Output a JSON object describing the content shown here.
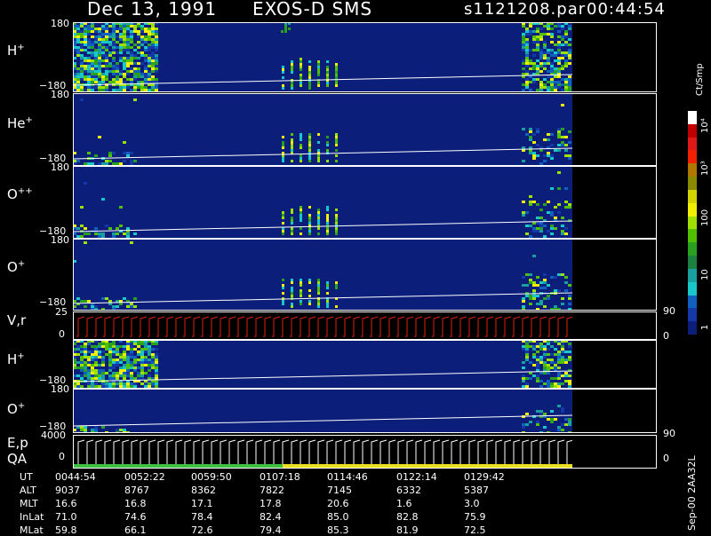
{
  "header": {
    "date": "Dec 13, 1991",
    "mission": "EXOS-D SMS",
    "file": "s1121208.par",
    "time": "00:44:54"
  },
  "panels": [
    {
      "label": "H",
      "sup": "+",
      "top_tick": "180",
      "bottom_tick": "−180"
    },
    {
      "label": "He",
      "sup": "+",
      "top_tick": "180",
      "bottom_tick": "−180"
    },
    {
      "label": "O",
      "sup": "++",
      "top_tick": "180",
      "bottom_tick": "−180"
    },
    {
      "label": "O",
      "sup": "+",
      "top_tick": "180",
      "bottom_tick": "−180"
    },
    {
      "label": "V,r",
      "sup": "",
      "top_tick": "25",
      "bottom_tick": "0"
    },
    {
      "label": "H",
      "sup": "+",
      "top_tick": "180",
      "bottom_tick": "−180"
    },
    {
      "label": "O",
      "sup": "+",
      "top_tick": "180",
      "bottom_tick": "−180"
    },
    {
      "label": "E,p",
      "sup": "",
      "top_tick": "4000",
      "bottom_tick": "0"
    },
    {
      "label": "QA",
      "sup": "",
      "top_tick": "",
      "bottom_tick": ""
    }
  ],
  "right_ticks": {
    "vr_top": "90",
    "vr_bottom": "0",
    "ep_top": "90",
    "ep_bottom": "0"
  },
  "colorbar": {
    "units": "Ct/Smp",
    "ticks": [
      "10⁴",
      "10³",
      "100",
      "10",
      "1"
    ],
    "colors": [
      "#ffffff",
      "#c00000",
      "#e01818",
      "#f02000",
      "#b07800",
      "#8a8a00",
      "#d4d400",
      "#f0f000",
      "#a0e000",
      "#50c000",
      "#2aa020",
      "#1c8040",
      "#18a0a0",
      "#18c8c8",
      "#1060c0",
      "#1438a8",
      "#0b1e7a"
    ]
  },
  "footer_text": "Sep-00  2AA32L",
  "orbit_table": {
    "labels": [
      "UT",
      "ALT",
      "MLT",
      "InLat",
      "MLat"
    ],
    "rows": [
      [
        "0044:54",
        "0052:22",
        "0059:50",
        "0107:18",
        "0114:46",
        "0122:14",
        "0129:42"
      ],
      [
        "9037",
        "8767",
        "8362",
        "7822",
        "7145",
        "6332",
        "5387"
      ],
      [
        "16.6",
        "16.8",
        "17.1",
        "17.8",
        "20.6",
        "1.6",
        "3.0"
      ],
      [
        "71.0",
        "74.6",
        "78.4",
        "82.4",
        "85.0",
        "82.8",
        "75.9"
      ],
      [
        "59.8",
        "66.1",
        "72.6",
        "79.4",
        "85.3",
        "81.9",
        "72.5"
      ]
    ]
  }
}
